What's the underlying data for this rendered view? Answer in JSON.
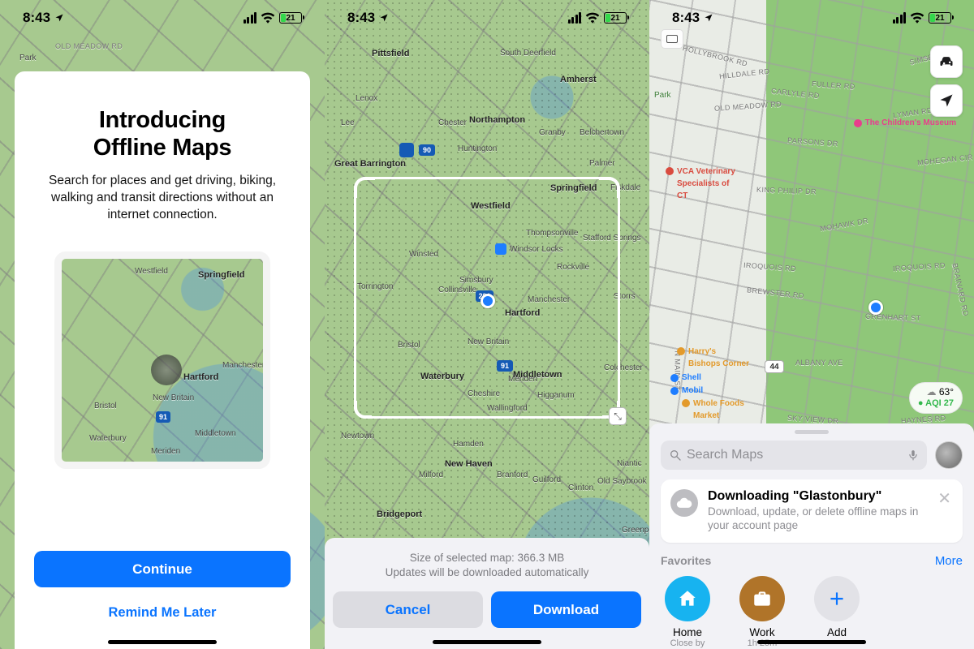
{
  "status": {
    "time": "8:43",
    "battery_pct": "21"
  },
  "screen1": {
    "title_line1": "Introducing",
    "title_line2": "Offline Maps",
    "subtitle": "Search for places and get driving, biking, walking and transit directions without an internet connection.",
    "continue": "Continue",
    "remind": "Remind Me Later",
    "minimap_places": [
      "Westfield",
      "Springfield",
      "Hartford",
      "Manchester",
      "New Britain",
      "Middletown",
      "Waterbury",
      "Bristol",
      "Meriden"
    ]
  },
  "screen2": {
    "map_places": [
      "Pittsfield",
      "South Deerfield",
      "Amherst",
      "Lenox",
      "Lee",
      "Chester",
      "Northampton",
      "Granby",
      "Belchertown",
      "Great Barrington",
      "Palmer",
      "Huntington",
      "Westfield",
      "Springfield",
      "Fiskdale",
      "Winsted",
      "Windsor Locks",
      "Thompsonville",
      "Stafford Springs",
      "Rockville",
      "Torrington",
      "Collinsville",
      "Simsbury",
      "Manchester",
      "Storrs",
      "Hartford",
      "New Britain",
      "Middletown",
      "Colchester",
      "Waterbury",
      "Bristol",
      "Meriden",
      "Cheshire",
      "Higganum",
      "Wallingford",
      "Newtown",
      "Hamden",
      "Milford",
      "Bridgeport",
      "New Haven",
      "Branford",
      "Guilford",
      "Clinton",
      "Old Saybrook",
      "Niantic",
      "Greenport"
    ],
    "size_line": "Size of selected map: 366.3 MB",
    "updates_line": "Updates will be downloaded automatically",
    "cancel": "Cancel",
    "download": "Download"
  },
  "screen3": {
    "street_names": [
      "OLD MEADOW RD",
      "HOLLYBROOK RD",
      "HILLDALE RD",
      "FULLER RD",
      "SIMSBURY",
      "CARLYLE RD",
      "LYMAN RD",
      "PARSONS DR",
      "MOHEGAN CIR",
      "KING PHILIP DR",
      "MOHAWK DR",
      "IROQUOIS RD",
      "IROQUOIS RD",
      "BREWSTER RD",
      "GRENHART ST",
      "ALBANY AVE",
      "N MAIN ST",
      "SKY VIEW DR",
      "HAYNES RD",
      "BRAINARD RD"
    ],
    "pois": {
      "childrens_museum": "The Children's Museum",
      "vca": "VCA Veterinary Specialists of CT",
      "harrys": "Harry's Bishops Corner",
      "shell": "Shell",
      "mobil": "Mobil",
      "wholefoods": "Whole Foods Market",
      "park": "Park"
    },
    "weather": {
      "temp": "63°",
      "aqi_label": "AQI 27"
    },
    "search_placeholder": "Search Maps",
    "download_card": {
      "title": "Downloading \"Glastonbury\"",
      "subtitle": "Download, update, or delete offline maps in your account page"
    },
    "favorites_header": "Favorites",
    "more": "More",
    "favorites": [
      {
        "label": "Home",
        "sub": "Close by",
        "color": "#17b3f0",
        "icon": "home"
      },
      {
        "label": "Work",
        "sub": "1h 25m",
        "color": "#b07429",
        "icon": "briefcase"
      },
      {
        "label": "Add",
        "sub": "",
        "color": "#e2e2e7",
        "icon": "plus"
      }
    ]
  }
}
